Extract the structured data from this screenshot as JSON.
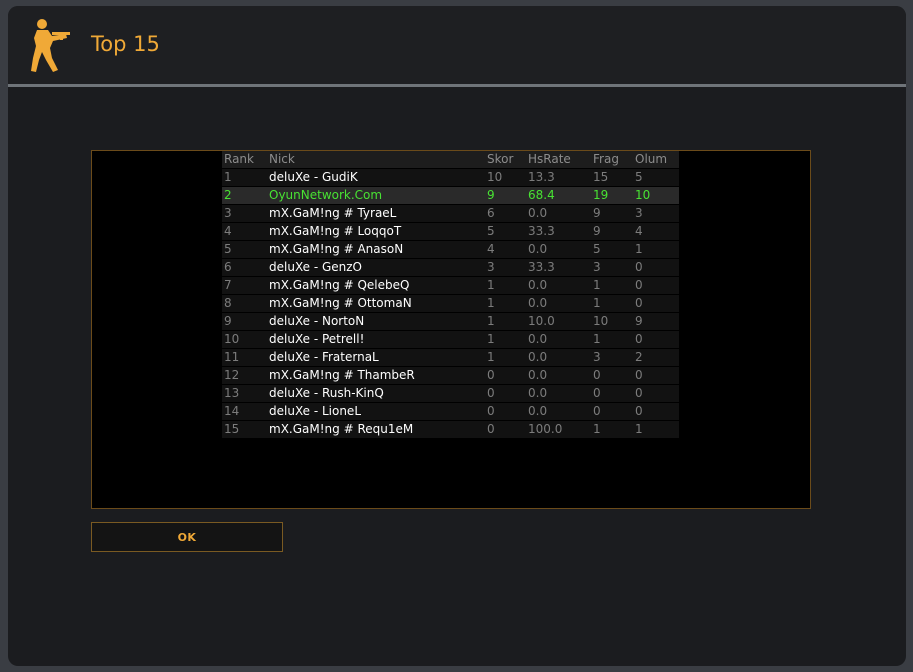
{
  "window": {
    "title": "Top 15",
    "logo_icon": "counter-terrorist-icon"
  },
  "colors": {
    "accent": "#f0a937",
    "highlight_text": "#48e233",
    "dim_text": "#7c7c7c"
  },
  "table": {
    "columns": [
      "Rank",
      "Nick",
      "Skor",
      "HsRate",
      "Frag",
      "Olum"
    ],
    "rows": [
      {
        "rank": "1",
        "nick": "deluXe - GudiK",
        "skor": "10",
        "hsrate": "13.3",
        "frag": "15",
        "olum": "5"
      },
      {
        "rank": "2",
        "nick": "OyunNetwork.Com",
        "skor": "9",
        "hsrate": "68.4",
        "frag": "19",
        "olum": "10"
      },
      {
        "rank": "3",
        "nick": "mX.GaM!ng # TyraeL",
        "skor": "6",
        "hsrate": "0.0",
        "frag": "9",
        "olum": "3"
      },
      {
        "rank": "4",
        "nick": "mX.GaM!ng # LoqqoT",
        "skor": "5",
        "hsrate": "33.3",
        "frag": "9",
        "olum": "4"
      },
      {
        "rank": "5",
        "nick": "mX.GaM!ng # AnasoN",
        "skor": "4",
        "hsrate": "0.0",
        "frag": "5",
        "olum": "1"
      },
      {
        "rank": "6",
        "nick": "deluXe - GenzO",
        "skor": "3",
        "hsrate": "33.3",
        "frag": "3",
        "olum": "0"
      },
      {
        "rank": "7",
        "nick": "mX.GaM!ng # QelebeQ",
        "skor": "1",
        "hsrate": "0.0",
        "frag": "1",
        "olum": "0"
      },
      {
        "rank": "8",
        "nick": "mX.GaM!ng # OttomaN",
        "skor": "1",
        "hsrate": "0.0",
        "frag": "1",
        "olum": "0"
      },
      {
        "rank": "9",
        "nick": "deluXe - NortoN",
        "skor": "1",
        "hsrate": "10.0",
        "frag": "10",
        "olum": "9"
      },
      {
        "rank": "10",
        "nick": "deluXe - Petrell!",
        "skor": "1",
        "hsrate": "0.0",
        "frag": "1",
        "olum": "0"
      },
      {
        "rank": "11",
        "nick": "deluXe - FraternaL",
        "skor": "1",
        "hsrate": "0.0",
        "frag": "3",
        "olum": "2"
      },
      {
        "rank": "12",
        "nick": "mX.GaM!ng # ThambeR",
        "skor": "0",
        "hsrate": "0.0",
        "frag": "0",
        "olum": "0"
      },
      {
        "rank": "13",
        "nick": "deluXe - Rush-KinQ",
        "skor": "0",
        "hsrate": "0.0",
        "frag": "0",
        "olum": "0"
      },
      {
        "rank": "14",
        "nick": "deluXe - LioneL",
        "skor": "0",
        "hsrate": "0.0",
        "frag": "0",
        "olum": "0"
      },
      {
        "rank": "15",
        "nick": "mX.GaM!ng # Requ1eM",
        "skor": "0",
        "hsrate": "100.0",
        "frag": "1",
        "olum": "1"
      }
    ],
    "highlight_rank": "2"
  },
  "buttons": {
    "ok_label": "OK"
  }
}
